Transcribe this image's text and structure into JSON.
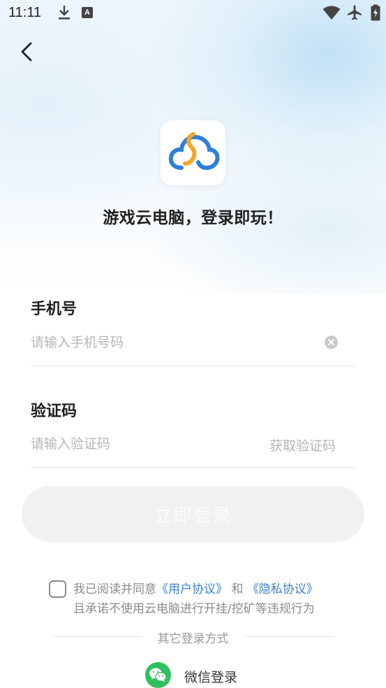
{
  "status_bar": {
    "time": "11:11",
    "notification_letter": "A"
  },
  "header": {
    "back_icon": "chevron-left-icon"
  },
  "brand": {
    "slogan": "游戏云电脑，登录即玩！",
    "colors": {
      "blue": "#2f7fd8",
      "orange": "#f4a623"
    }
  },
  "form": {
    "phone": {
      "label": "手机号",
      "placeholder": "请输入手机号码",
      "value": ""
    },
    "code": {
      "label": "验证码",
      "placeholder": "请输入验证码",
      "value": "",
      "get_code_label": "获取验证码"
    },
    "login_button": "立即登录"
  },
  "agreement": {
    "prefix": "我已阅读并同意",
    "user_agreement": "《用户协议》",
    "and": "和",
    "privacy_policy": "《隐私协议》",
    "line2": "且承诺不使用云电脑进行开挂/挖矿等违规行为",
    "checked": false
  },
  "other_login": {
    "title": "其它登录方式",
    "wechat_label": "微信登录",
    "wechat_color": "#2fc160"
  }
}
